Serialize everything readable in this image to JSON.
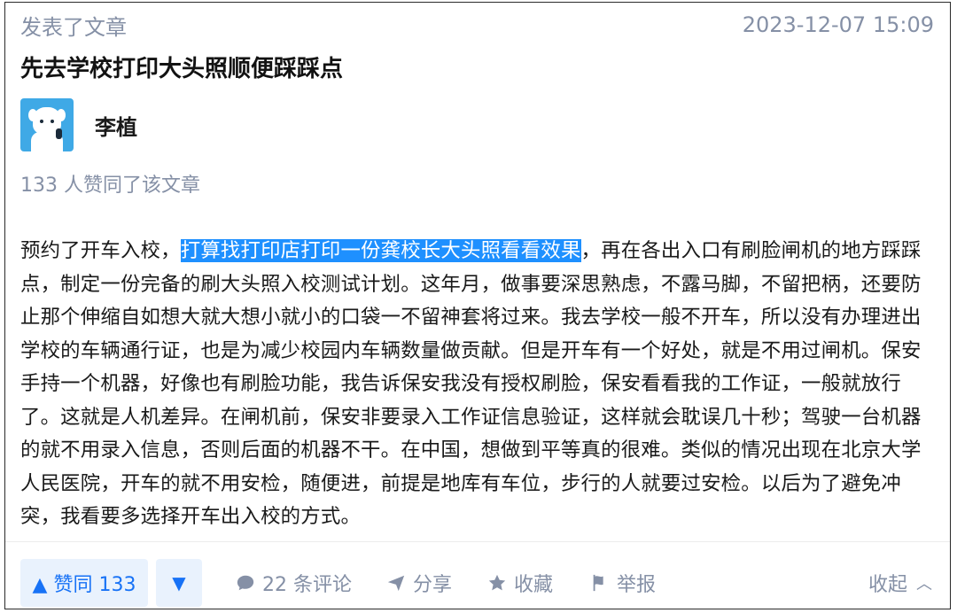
{
  "header": {
    "activity": "发表了文章",
    "timestamp": "2023-12-07 15:09"
  },
  "article": {
    "title": "先去学校打印大头照顺便踩踩点",
    "author": "李植",
    "likes_summary": "133 人赞同了该文章",
    "body_before": "预约了开车入校，",
    "body_highlight": "打算找打印店打印一份龚校长大头照看看效果",
    "body_after": "，再在各出入口有刷脸闸机的地方踩踩点，制定一份完备的刷大头照入校测试计划。这年月，做事要深思熟虑，不露马脚，不留把柄，还要防止那个伸缩自如想大就大想小就小的口袋一不留神套将过来。我去学校一般不开车，所以没有办理进出学校的车辆通行证，也是为减少校园内车辆数量做贡献。但是开车有一个好处，就是不用过闸机。保安手持一个机器，好像也有刷脸功能，我告诉保安我没有授权刷脸，保安看看我的工作证，一般就放行了。这就是人机差异。在闸机前，保安非要录入工作证信息验证，这样就会耽误几十秒；驾驶一台机器的就不用录入信息，否则后面的机器不干。在中国，想做到平等真的很难。类似的情况出现在北京大学人民医院，开车的就不用安检，随便进，前提是地库有车位，步行的人就要过安检。以后为了避免冲突，我看要多选择开车出入校的方式。"
  },
  "actions": {
    "vote_up": "▲ 赞同 133",
    "vote_down": "▼",
    "comments": "22 条评论",
    "share": "分享",
    "favorite": "收藏",
    "report": "举报",
    "collapse": "收起",
    "collapse_chevron": "︿"
  },
  "colors": {
    "accent": "#1772f6",
    "vote_bg": "#e9f2fd",
    "muted": "#8590a6",
    "highlight": "#1e90ff",
    "avatar_bg": "#3fa9e6"
  },
  "icons": [
    "comment-icon",
    "share-icon",
    "star-icon",
    "flag-icon",
    "chevron-up-icon",
    "caret-up-icon",
    "caret-down-icon"
  ]
}
